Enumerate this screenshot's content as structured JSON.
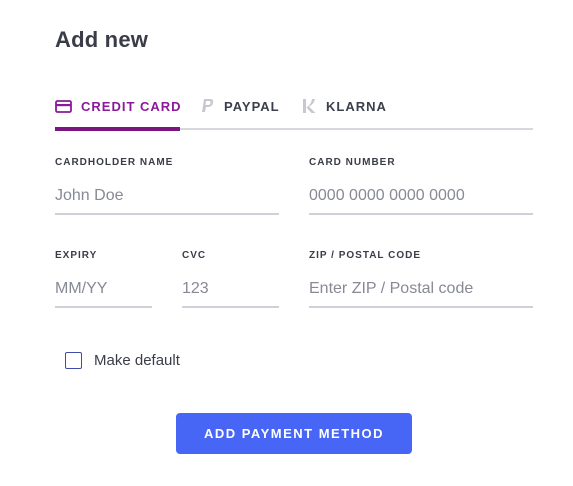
{
  "header": {
    "title": "Add new"
  },
  "tabs": [
    {
      "label": "CREDIT CARD",
      "icon": "credit-card-icon",
      "active": true
    },
    {
      "label": "PAYPAL",
      "icon": "paypal-icon",
      "active": false
    },
    {
      "label": "KLARNA",
      "icon": "klarna-icon",
      "active": false
    }
  ],
  "form": {
    "cardholder_name": {
      "label": "CARDHOLDER NAME",
      "placeholder": "John Doe",
      "value": ""
    },
    "card_number": {
      "label": "CARD NUMBER",
      "placeholder": "0000 0000 0000 0000",
      "value": ""
    },
    "expiry": {
      "label": "EXPIRY",
      "placeholder": "MM/YY",
      "value": ""
    },
    "cvc": {
      "label": "CVC",
      "placeholder": "123",
      "value": ""
    },
    "zip": {
      "label": "ZIP / POSTAL CODE",
      "placeholder": "Enter ZIP / Postal code",
      "value": ""
    },
    "make_default": {
      "label": "Make default",
      "checked": false
    },
    "submit_label": "ADD PAYMENT METHOD"
  },
  "colors": {
    "accent": "#7d1580",
    "active_tab_text": "#8a1a9a",
    "button": "#4766f5",
    "checkbox_border": "#3d4ea8"
  }
}
